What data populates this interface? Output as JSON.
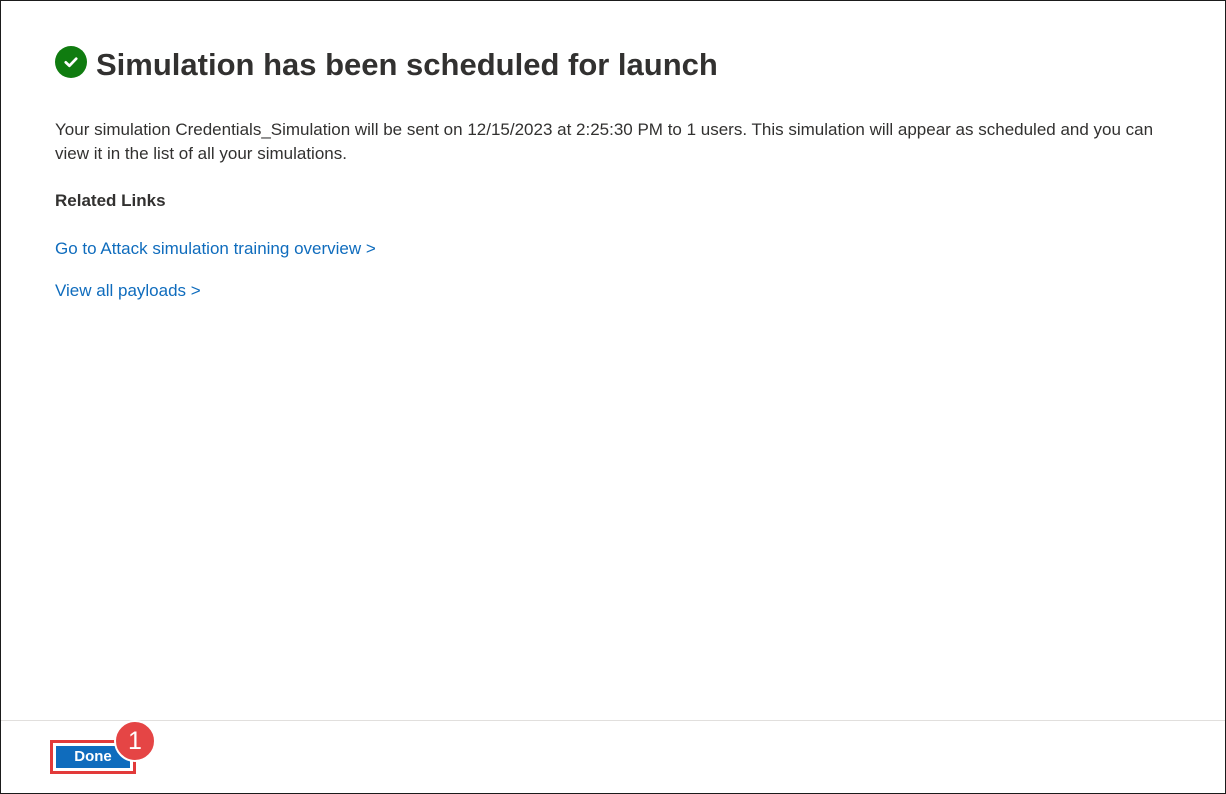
{
  "header": {
    "title": "Simulation has been scheduled for launch",
    "status_icon": "check-circle-icon",
    "status_color": "#107c10"
  },
  "main": {
    "description": "Your simulation Credentials_Simulation will be sent on 12/15/2023 at 2:25:30 PM to 1 users. This simulation will appear as scheduled and you can view it in the list of all your simulations.",
    "related_links_heading": "Related Links",
    "links": [
      {
        "label": "Go to Attack simulation training overview >"
      },
      {
        "label": "View all payloads >"
      }
    ]
  },
  "footer": {
    "done_label": "Done",
    "step_badge": "1"
  },
  "colors": {
    "accent": "#0f6cbd",
    "badge": "#e54545",
    "highlight_outline": "#e23a3a"
  }
}
